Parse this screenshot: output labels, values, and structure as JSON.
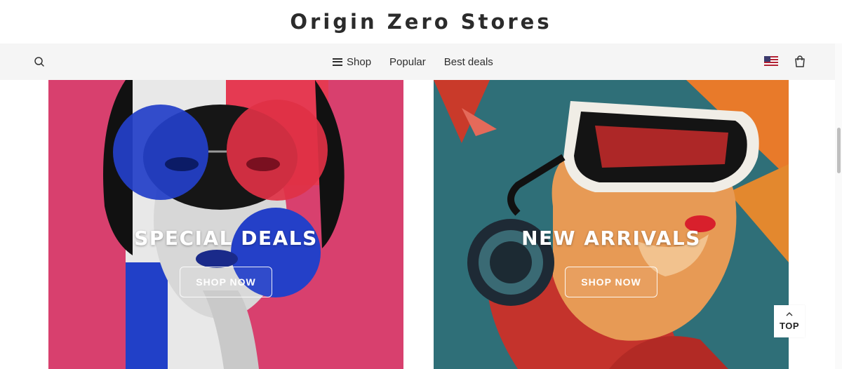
{
  "brand": {
    "title": "Origin Zero Stores"
  },
  "nav": {
    "search_icon": "search-icon",
    "items": [
      {
        "label": "Shop",
        "icon": "hamburger-menu-icon"
      },
      {
        "label": "Popular"
      },
      {
        "label": "Best deals"
      }
    ],
    "flag_icon": "us-flag-icon",
    "cart_icon": "shopping-bag-icon"
  },
  "cards": [
    {
      "title": "SPECIAL DEALS",
      "button": "SHOP NOW",
      "accent": "#d8406e"
    },
    {
      "title": "NEW ARRIVALS",
      "button": "SHOP NOW",
      "accent": "#2f6f78"
    }
  ],
  "back_to_top": {
    "label": "TOP",
    "icon": "chevron-up-icon"
  }
}
